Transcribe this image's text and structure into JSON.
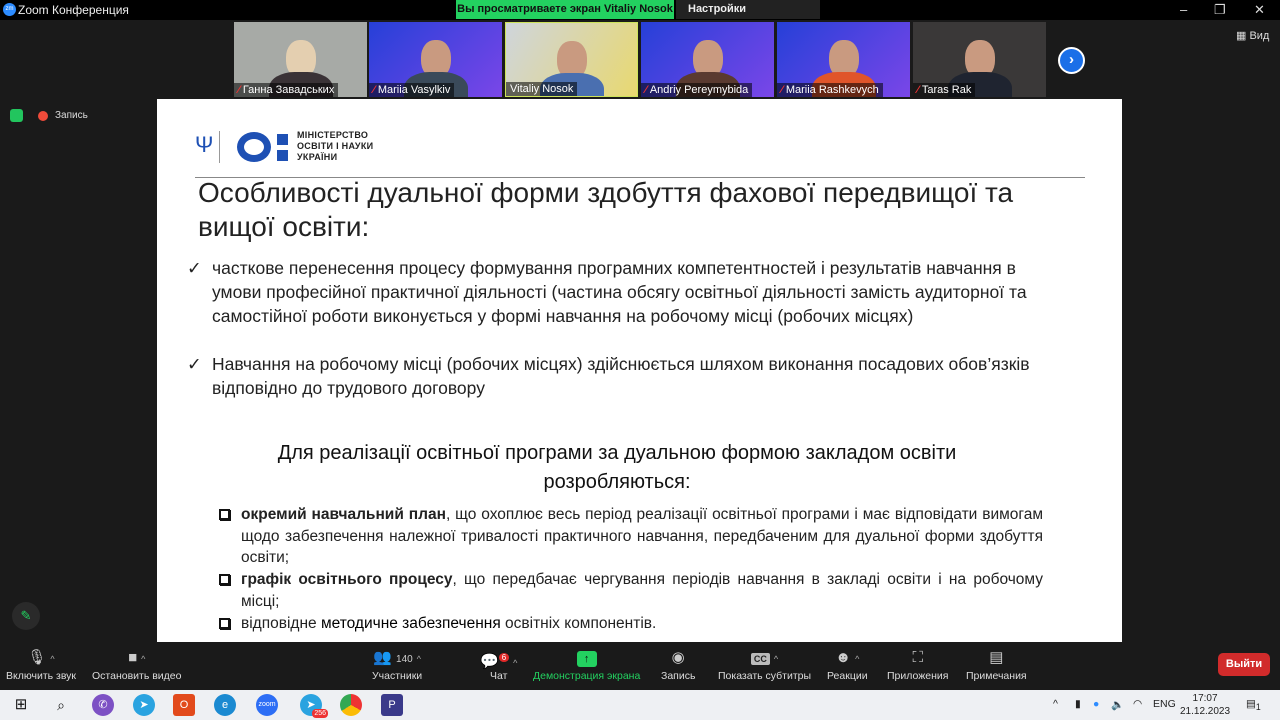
{
  "window": {
    "title": "Zoom Конференция",
    "banner": "Вы просматриваете экран Vitaliy Nosok",
    "view_settings": "Настройки просмотра",
    "view": "Вид",
    "recording": "Запись"
  },
  "participants": [
    {
      "name": "Ганна Завадських",
      "muted": true
    },
    {
      "name": "Mariia Vasylkiv",
      "muted": true
    },
    {
      "name": "Vitaliy Nosok",
      "muted": false
    },
    {
      "name": "Andriy Pereymybida",
      "muted": true
    },
    {
      "name": "Mariia Rashkevych",
      "muted": true
    },
    {
      "name": "Taras Rak",
      "muted": true
    }
  ],
  "slide": {
    "ministry": [
      "МІНІСТЕРСТВО",
      "ОСВІТИ І НАУКИ",
      "УКРАЇНИ"
    ],
    "title": "Особливості дуальної форми здобуття фахової передвищої та вищої освіти:",
    "bullets": [
      "часткове перенесення процесу формування програмних компетентностей і результатів навчання в умови професійної практичної діяльності (частина обсягу освітньої діяльності замість аудиторної та самостійної роботи виконується у формі навчання на робочому місці (робочих місцях)",
      "Навчання на робочому місці (робочих місцях) здійснюється шляхом виконання посадових обов’язків відповідно до трудового договору"
    ],
    "heading": "Для реалізації освітньої програми за дуальною формою закладом освіти розробляються:",
    "items": [
      {
        "pre": "",
        "bold": "окремий навчальний план",
        "post": ", що охоплює весь період реалізації освітньої програми і має відповідати вимогам щодо забезпечення належної тривалості практичного навчання, передбаченим для дуальної форми здобуття освіти;"
      },
      {
        "pre": "",
        "bold": "графік освітнього процесу",
        "post": ", що передбачає чергування періодів навчання в закладі освіти і на робочому місці;"
      },
      {
        "pre": "відповідне ",
        "bold": "методичне забезпечення",
        "post": " освітніх компонентів."
      }
    ]
  },
  "toolbar": {
    "unmute": "Включить звук",
    "stop_video": "Остановить видео",
    "participants": "Участники",
    "participants_count": "140",
    "chat": "Чат",
    "chat_badge": "6",
    "share": "Демонстрация экрана",
    "record": "Запись",
    "captions": "Показать субтитры",
    "cc": "CC",
    "reactions": "Реакции",
    "apps": "Приложения",
    "notes": "Примечания",
    "leave": "Выйти"
  },
  "taskbar": {
    "zoom": "zoom",
    "telegram_badge": "256",
    "lang": "ENG",
    "time": "17:07",
    "date": "21.12.2023",
    "notif": "1"
  },
  "colors": {
    "share_green": "#23d160",
    "leave_red": "#d12b2b",
    "brand_blue": "#1e50b4"
  }
}
